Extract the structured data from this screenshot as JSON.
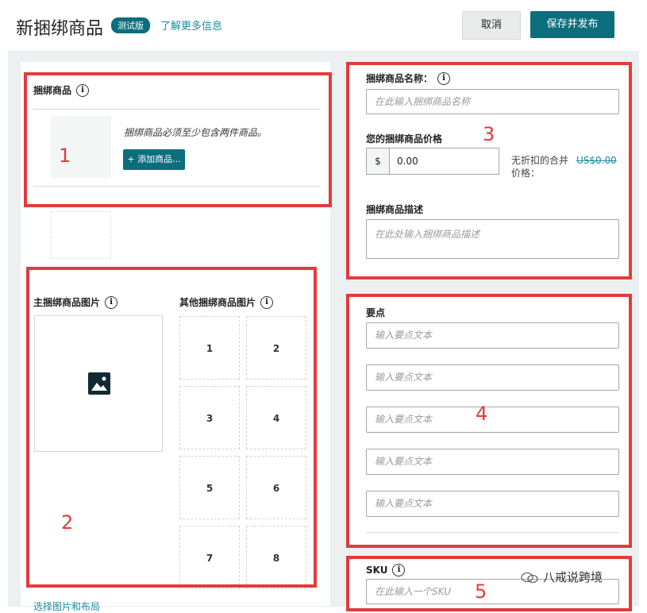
{
  "header": {
    "title": "新捆绑商品",
    "beta_badge": "测试版",
    "learn_more": "了解更多信息",
    "cancel": "取消",
    "save_publish": "保存并发布"
  },
  "bundle_products": {
    "label": "捆绑商品",
    "note": "捆绑商品必须至少包含两件商品。",
    "add_button": "+ 添加商品..."
  },
  "images": {
    "main_label": "主捆绑商品图片",
    "other_label": "其他捆绑商品图片",
    "slots": [
      "1",
      "2",
      "3",
      "4",
      "5",
      "6",
      "7",
      "8"
    ],
    "bottom_link": "选择图片和布局"
  },
  "details": {
    "name_label": "捆绑商品名称：",
    "name_placeholder": "在此输入捆绑商品名称",
    "price_label": "您的捆绑商品价格",
    "currency_symbol": "$",
    "price_value": "0.00",
    "undiscounted_label": "无折扣的合并价格：",
    "undiscounted_value": "US$0.00",
    "desc_label": "捆绑商品描述",
    "desc_placeholder": "在此处输入捆绑商品描述"
  },
  "bullets": {
    "label": "要点",
    "placeholders": [
      "输入要点文本",
      "输入要点文本",
      "输入要点文本",
      "输入要点文本",
      "输入要点文本"
    ]
  },
  "sku": {
    "label": "SKU",
    "placeholder": "在此输入一个SKU"
  },
  "annotations": [
    "1",
    "2",
    "3",
    "4",
    "5"
  ],
  "watermark": "八戒说跨境"
}
